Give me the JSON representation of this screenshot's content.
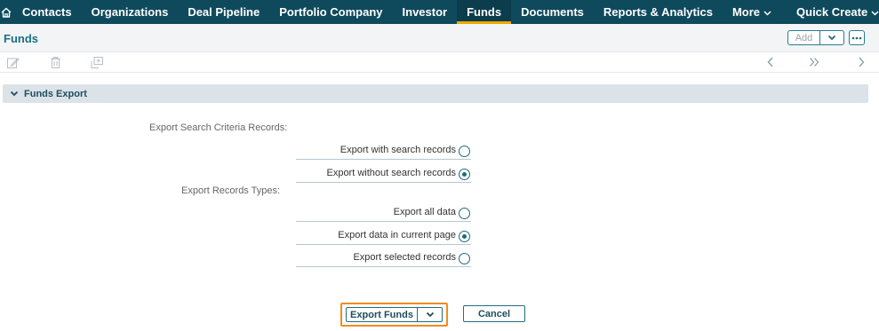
{
  "nav": {
    "items": [
      {
        "label": "Contacts"
      },
      {
        "label": "Organizations"
      },
      {
        "label": "Deal Pipeline"
      },
      {
        "label": "Portfolio Company"
      },
      {
        "label": "Investor"
      },
      {
        "label": "Funds"
      },
      {
        "label": "Documents"
      },
      {
        "label": "Reports & Analytics"
      },
      {
        "label": "More"
      },
      {
        "label": "Quick Create"
      }
    ],
    "active": "Funds"
  },
  "header": {
    "title": "Funds",
    "add_label": "Add"
  },
  "section": {
    "title": "Funds Export"
  },
  "form": {
    "criteria_label": "Export Search Criteria Records:",
    "criteria_options": [
      {
        "label": "Export with search records",
        "checked": false
      },
      {
        "label": "Export without search records",
        "checked": true
      }
    ],
    "types_label": "Export Records Types:",
    "types_options": [
      {
        "label": "Export all data",
        "checked": false
      },
      {
        "label": "Export data in current page",
        "checked": true
      },
      {
        "label": "Export selected records",
        "checked": false
      }
    ]
  },
  "footer": {
    "export_label": "Export Funds",
    "cancel_label": "Cancel"
  },
  "colors": {
    "nav_bg": "#0f4a5c",
    "accent": "#1d6b7e",
    "highlight": "#f28c1e",
    "active_tab_underline": "#f0a800"
  }
}
